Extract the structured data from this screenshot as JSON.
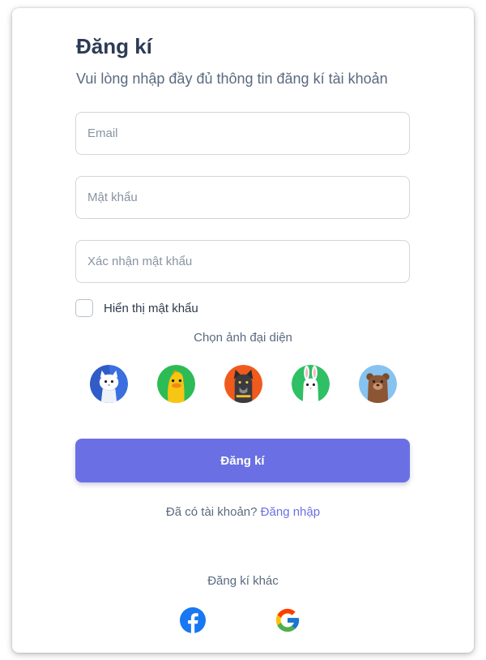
{
  "form": {
    "title": "Đăng kí",
    "subtitle": "Vui lòng nhập đầy đủ thông tin đăng kí tài khoản",
    "email_placeholder": "Email",
    "password_placeholder": "Mật khẩu",
    "confirm_placeholder": "Xác nhận mật khẩu",
    "show_password_label": "Hiển thị mật khẩu",
    "show_password_checked": false
  },
  "avatars": {
    "heading": "Chọn ảnh đại diện",
    "items": [
      {
        "name": "cat",
        "bg": "#3b6fe0"
      },
      {
        "name": "duck",
        "bg": "#2dbb55"
      },
      {
        "name": "dog",
        "bg": "#f05a1c"
      },
      {
        "name": "rabbit",
        "bg": "#2fbf64"
      },
      {
        "name": "bear",
        "bg": "#86c3f0"
      }
    ]
  },
  "submit": {
    "label": "Đăng kí",
    "color": "#6a70e3"
  },
  "login": {
    "prompt": "Đã có tài khoản?",
    "link": "Đăng nhập"
  },
  "alternative": {
    "heading": "Đăng kí khác",
    "providers": [
      "facebook-icon",
      "google-icon"
    ]
  }
}
